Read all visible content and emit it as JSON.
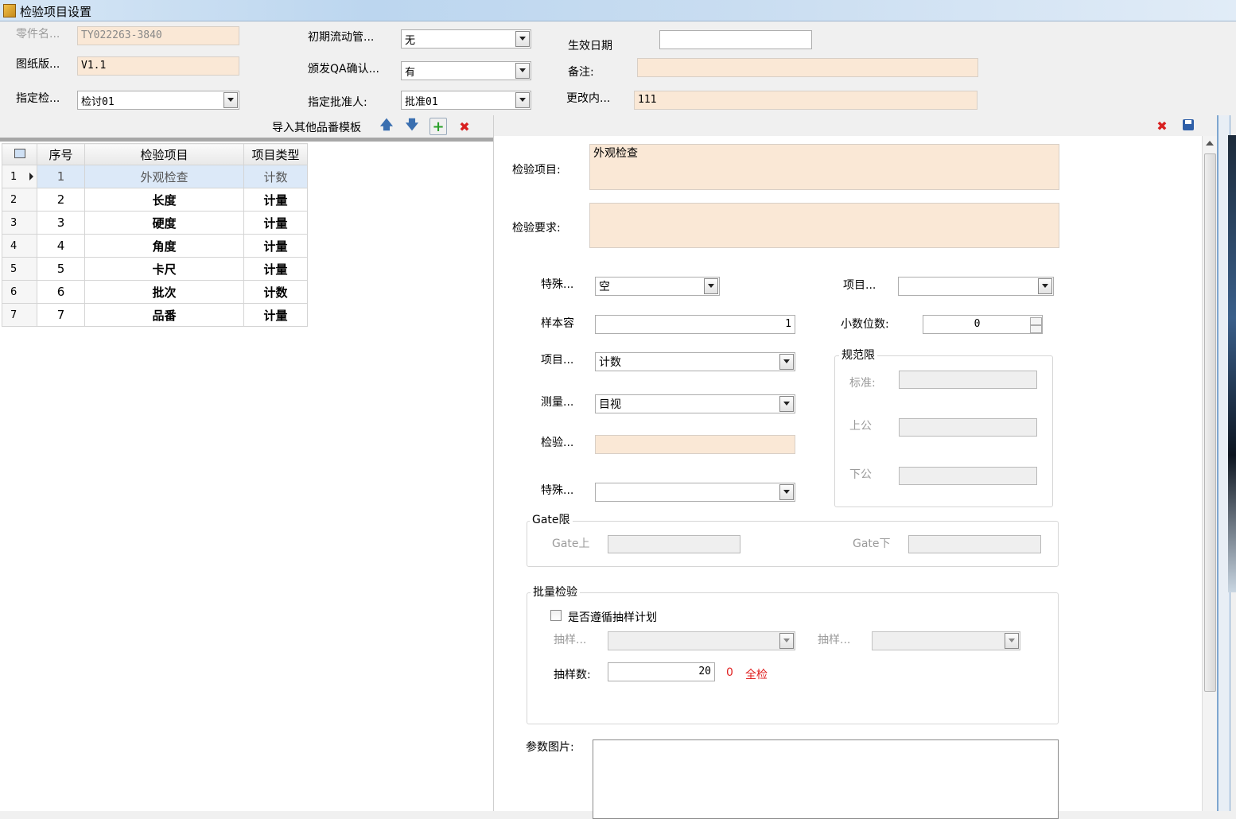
{
  "window": {
    "title": "检验项目设置"
  },
  "header": {
    "part_name_label": "零件名...",
    "part_name_value": "TY022263-3840",
    "drawing_label": "图纸版...",
    "drawing_value": "V1.1",
    "assign_check_label": "指定检...",
    "assign_check_value": "检讨01",
    "initial_flow_label": "初期流动管...",
    "initial_flow_value": "无",
    "qa_confirm_label": "颁发QA确认...",
    "qa_confirm_value": "有",
    "approver_label": "指定批准人:",
    "approver_value": "批准01",
    "effective_date_label": "生效日期",
    "effective_date_value": "",
    "remark_label": "备注:",
    "remark_value": "",
    "change_label": "更改内...",
    "change_value": "111"
  },
  "toolbar": {
    "import_label": "导入其他品番模板"
  },
  "grid": {
    "columns": [
      "序号",
      "检验项目",
      "项目类型"
    ],
    "rows": [
      {
        "rownum": "1",
        "seq": "1",
        "item": "外观检查",
        "type": "计数"
      },
      {
        "rownum": "2",
        "seq": "2",
        "item": "长度",
        "type": "计量"
      },
      {
        "rownum": "3",
        "seq": "3",
        "item": "硬度",
        "type": "计量"
      },
      {
        "rownum": "4",
        "seq": "4",
        "item": "角度",
        "type": "计量"
      },
      {
        "rownum": "5",
        "seq": "5",
        "item": "卡尺",
        "type": "计量"
      },
      {
        "rownum": "6",
        "seq": "6",
        "item": "批次",
        "type": "计数"
      },
      {
        "rownum": "7",
        "seq": "7",
        "item": "品番",
        "type": "计量"
      }
    ]
  },
  "detail": {
    "item_label": "检验项目:",
    "item_value": "外观检查",
    "req_label": "检验要求:",
    "req_value": "",
    "special_label": "特殊...",
    "special_value": "空",
    "item_cat_label": "项目...",
    "item_cat_value": "",
    "sample_label": "样本容",
    "sample_value": "1",
    "decimal_label": "小数位数:",
    "decimal_value": "0",
    "item_type_label": "项目...",
    "item_type_value": "计数",
    "measure_label": "测量...",
    "measure_value": "目视",
    "inspect_label": "检验...",
    "inspect_value": "",
    "special2_label": "特殊...",
    "special2_value": "",
    "spec_group": "规范限",
    "std_label": "标准:",
    "upper_label": "上公",
    "lower_label": "下公",
    "gate_group": "Gate限",
    "gate_upper_label": "Gate上",
    "gate_lower_label": "Gate下",
    "batch_group": "批量检验",
    "follow_plan_label": "是否遵循抽样计划",
    "sampling1_label": "抽样...",
    "sampling2_label": "抽样...",
    "sample_count_label": "抽样数:",
    "sample_count_value": "20",
    "sample_zero": "0",
    "full_check": "全检",
    "param_image_label": "参数图片:"
  }
}
